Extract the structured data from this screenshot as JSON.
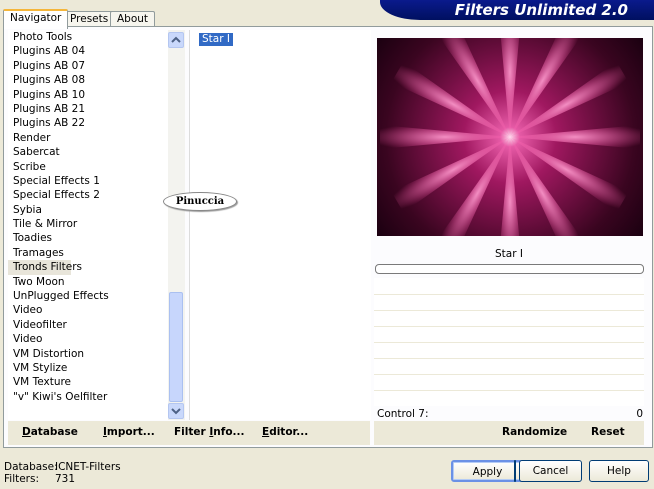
{
  "banner": {
    "title": "Filters Unlimited 2.0"
  },
  "tabs": [
    {
      "label": "Navigator",
      "active": true
    },
    {
      "label": "Presets",
      "active": false
    },
    {
      "label": "About",
      "active": false
    }
  ],
  "categories": [
    "Photo Tools",
    "Plugins AB 04",
    "Plugins AB 07",
    "Plugins AB 08",
    "Plugins AB 10",
    "Plugins AB 21",
    "Plugins AB 22",
    "Render",
    "Sabercat",
    "Scribe",
    "Special Effects 1",
    "Special Effects 2",
    "Sybia",
    "Tile & Mirror",
    "Toadies",
    "Tramages",
    "Tronds Filters",
    "Two Moon",
    "UnPlugged Effects",
    "Video",
    "Videofilter",
    "Video",
    "VM Distortion",
    "VM Stylize",
    "VM Texture",
    "\"v\" Kiwi's Oelfilter"
  ],
  "selected_category": "Tronds Filters",
  "filters": {
    "items": [
      "Star I"
    ],
    "selected": "Star I"
  },
  "watermark": {
    "text": "Pinuccia"
  },
  "preview": {
    "filter_name": "Star I",
    "progress": 0
  },
  "control": {
    "label": "Control 7:",
    "value": "0"
  },
  "toolbar_left": [
    {
      "label": "Database",
      "u": "D"
    },
    {
      "label": "Import...",
      "u": "I"
    },
    {
      "label": "Filter Info...",
      "u": "I"
    },
    {
      "label": "Editor...",
      "u": "E"
    }
  ],
  "toolbar_right": {
    "randomize": "Randomize",
    "reset": "Reset"
  },
  "status": {
    "database_label": "Database:",
    "database_value": "ICNET-Filters",
    "filters_label": "Filters:",
    "filters_value": "731"
  },
  "buttons": {
    "apply": "Apply",
    "cancel": "Cancel",
    "help": "Help"
  },
  "colors": {
    "banner": "#0a1a8c",
    "selection": "#316ac5",
    "preview_pink": "#e65aa6"
  }
}
